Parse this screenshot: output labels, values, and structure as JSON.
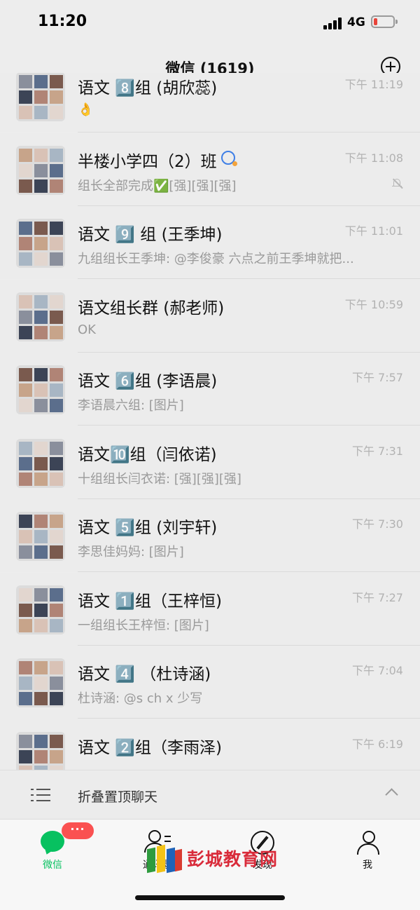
{
  "status_bar": {
    "time": "11:20",
    "network": "4G",
    "battery_level": 0.2
  },
  "header": {
    "title": "微信 (1619)"
  },
  "chats": [
    {
      "title": "语文 8️⃣组 (胡欣蕊)",
      "time": "下午 11:19",
      "preview": "👌",
      "muted": false,
      "has_status_icon": false
    },
    {
      "title": "半楼小学四（2）班",
      "time": "下午 11:08",
      "preview": "组长全部完成✅[强][强][强]",
      "muted": true,
      "has_status_icon": true
    },
    {
      "title": "语文 9️⃣ 组 (王季坤)",
      "time": "下午 11:01",
      "preview": "九组组长王季坤: @李俊豪 六点之前王季坤就把...",
      "muted": false,
      "has_status_icon": false
    },
    {
      "title": "语文组长群 (郝老师)",
      "time": "下午 10:59",
      "preview": "OK",
      "muted": false,
      "has_status_icon": false
    },
    {
      "title": "语文 6️⃣组 (李语晨)",
      "time": "下午 7:57",
      "preview": "李语晨六组: [图片]",
      "muted": false,
      "has_status_icon": false
    },
    {
      "title": "语文🔟组（闫依诺)",
      "time": "下午 7:31",
      "preview": "十组组长闫衣诺: [强][强][强]",
      "muted": false,
      "has_status_icon": false
    },
    {
      "title": "语文 5️⃣组 (刘宇轩)",
      "time": "下午 7:30",
      "preview": "李思佳妈妈: [图片]",
      "muted": false,
      "has_status_icon": false
    },
    {
      "title": "语文 1️⃣组（王梓恒)",
      "time": "下午 7:27",
      "preview": "一组组长王梓恒: [图片]",
      "muted": false,
      "has_status_icon": false
    },
    {
      "title": "语文 4️⃣ （杜诗涵)",
      "time": "下午 7:04",
      "preview": "杜诗涵: @s ch x 少写",
      "muted": false,
      "has_status_icon": false
    },
    {
      "title": "语文 2️⃣组（李雨泽)",
      "time": "下午 6:19",
      "preview": "",
      "muted": false,
      "has_status_icon": false
    }
  ],
  "folded": {
    "label": "折叠置顶聊天"
  },
  "tabs": [
    {
      "label": "微信",
      "icon": "chats-icon",
      "active": true,
      "badge": "···"
    },
    {
      "label": "通讯录",
      "icon": "contacts-icon",
      "active": false
    },
    {
      "label": "发现",
      "icon": "discover-icon",
      "active": false
    },
    {
      "label": "我",
      "icon": "me-icon",
      "active": false
    }
  ],
  "watermark": {
    "text": "彭城教育网"
  },
  "colors": {
    "accent": "#07c160",
    "badge": "#fa5151",
    "background": "#ededed"
  }
}
